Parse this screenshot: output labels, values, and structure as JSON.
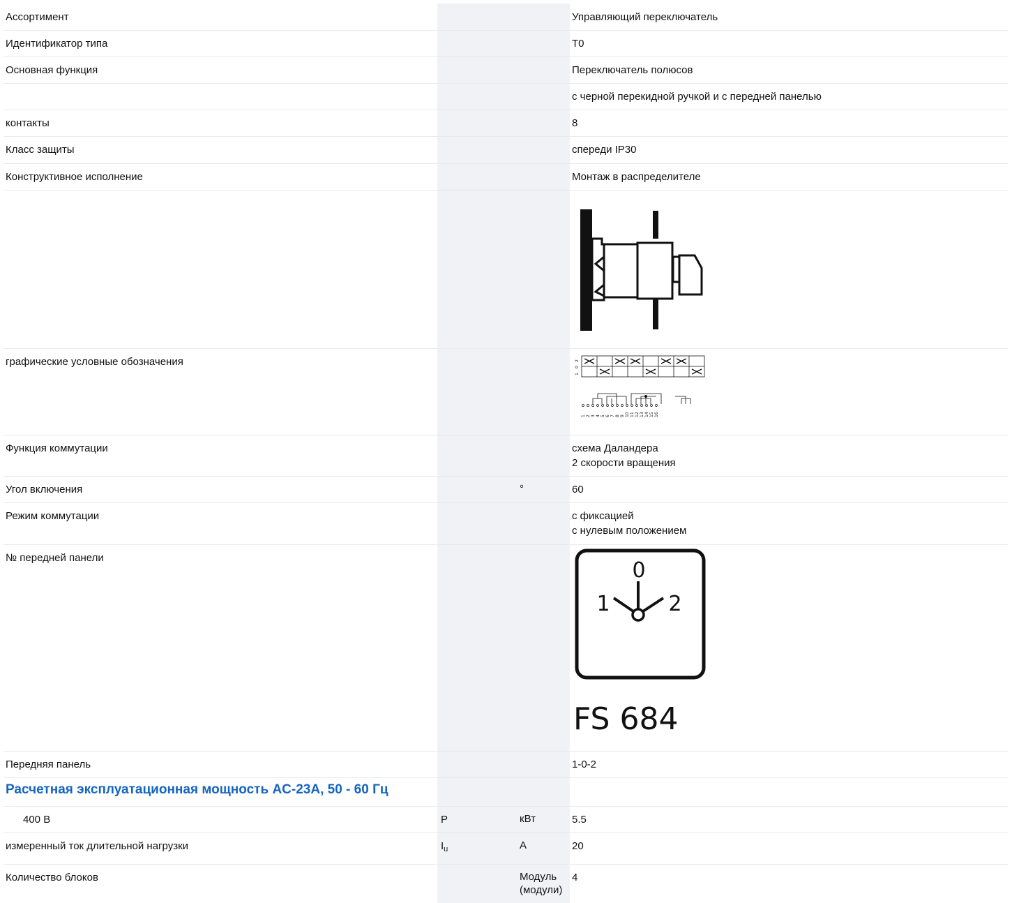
{
  "rows": [
    {
      "label": "Ассортимент",
      "symbol": "",
      "unit": "",
      "value": "Управляющий переключатель"
    },
    {
      "label": "Идентификатор типа",
      "symbol": "",
      "unit": "",
      "value": "T0"
    },
    {
      "label": "Основная функция",
      "symbol": "",
      "unit": "",
      "value": "Переключатель полюсов"
    },
    {
      "label": "",
      "symbol": "",
      "unit": "",
      "value": "с черной перекидной ручкой и с передней панелью"
    },
    {
      "label": "контакты",
      "symbol": "",
      "unit": "",
      "value": "8"
    },
    {
      "label": "Класс защиты",
      "symbol": "",
      "unit": "",
      "value": "спереди IP30"
    },
    {
      "label": "Конструктивное исполнение",
      "symbol": "",
      "unit": "",
      "value": "Монтаж в распределителе"
    },
    {
      "label": "графические условные обозначения"
    },
    {
      "label": "Функция коммутации",
      "value_lines": [
        "схема Даландера",
        "2 скорости вращения"
      ]
    },
    {
      "label": "Угол включения",
      "unit": "°",
      "value": "60"
    },
    {
      "label": "Режим коммутации",
      "value_lines": [
        "с фиксацией",
        "с нулевым положением"
      ]
    },
    {
      "label": "№ передней панели",
      "front_plate_caption": "FS 684",
      "dial_positions": [
        "0",
        "1",
        "2"
      ]
    },
    {
      "label": "Передняя панель",
      "value": "1-0-2"
    },
    {
      "heading": "Расчетная эксплуатационная мощность AC-23A, 50 - 60 Гц"
    },
    {
      "label": "400 В",
      "symbol": "P",
      "unit": "кВт",
      "value": "5.5"
    },
    {
      "label": "измеренный ток длительной нагрузки",
      "symbol": "I",
      "symbol_sub": "u",
      "unit": "A",
      "value": "20"
    },
    {
      "label": "Количество блоков",
      "unit_lines": [
        "Модуль",
        "(модули)"
      ],
      "value": "4"
    }
  ],
  "symbol_diagram": {
    "position_labels": [
      "2",
      "0",
      "1"
    ],
    "terminal_numbers": [
      "1",
      "2",
      "3",
      "4",
      "5",
      "6",
      "7",
      "8",
      "9",
      "10",
      "11",
      "12",
      "13",
      "14",
      "15",
      "16"
    ]
  },
  "colors": {
    "heading": "#1565c0",
    "stripe": "#f0f2f5",
    "divider": "#e6e9ee"
  }
}
